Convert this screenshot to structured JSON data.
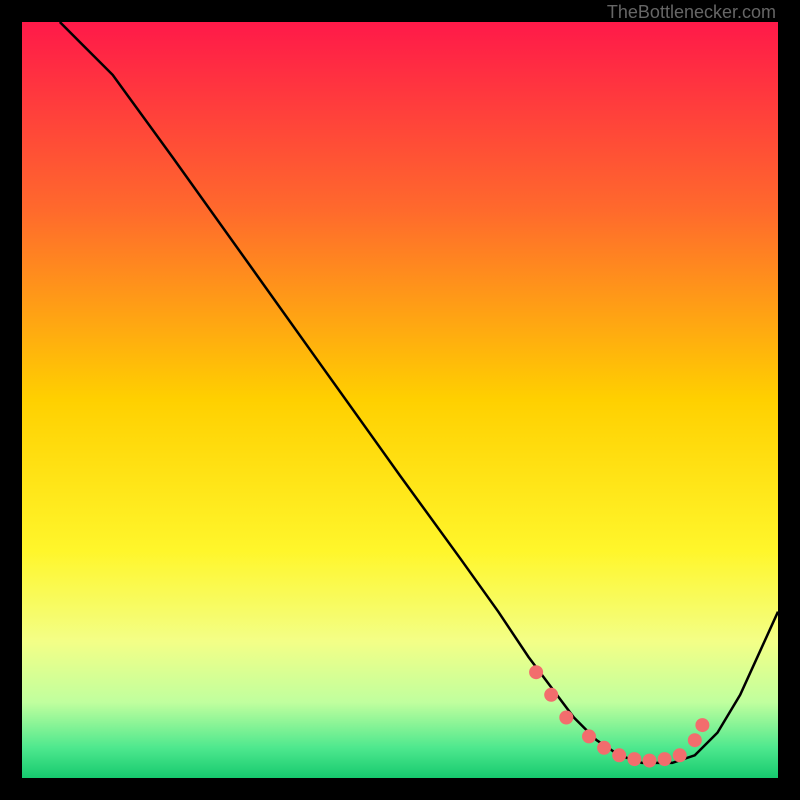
{
  "watermark": "TheBottlenecker.com",
  "chart_data": {
    "type": "line",
    "title": "",
    "xlabel": "",
    "ylabel": "",
    "xlim": [
      0,
      100
    ],
    "ylim": [
      0,
      100
    ],
    "series": [
      {
        "name": "bottleneck-curve",
        "x": [
          5,
          8,
          12,
          20,
          30,
          40,
          50,
          58,
          63,
          67,
          70,
          73,
          76,
          79,
          82,
          84,
          86,
          89,
          92,
          95,
          100
        ],
        "y": [
          100,
          97,
          93,
          82,
          68,
          54,
          40,
          29,
          22,
          16,
          12,
          8,
          5,
          3,
          2,
          2,
          2,
          3,
          6,
          11,
          22
        ]
      }
    ],
    "dots": {
      "name": "data-points",
      "x": [
        68,
        70,
        72,
        75,
        77,
        79,
        81,
        83,
        85,
        87,
        89,
        90
      ],
      "y": [
        14,
        11,
        8,
        5.5,
        4,
        3,
        2.5,
        2.3,
        2.5,
        3,
        5,
        7
      ]
    },
    "gradient_stops": [
      {
        "offset": 0,
        "color": "#ff1949"
      },
      {
        "offset": 0.25,
        "color": "#ff6a2c"
      },
      {
        "offset": 0.5,
        "color": "#ffd000"
      },
      {
        "offset": 0.7,
        "color": "#fff62b"
      },
      {
        "offset": 0.82,
        "color": "#f3ff87"
      },
      {
        "offset": 0.9,
        "color": "#c0ff9e"
      },
      {
        "offset": 0.96,
        "color": "#4ee88e"
      },
      {
        "offset": 1.0,
        "color": "#16c96e"
      }
    ]
  }
}
